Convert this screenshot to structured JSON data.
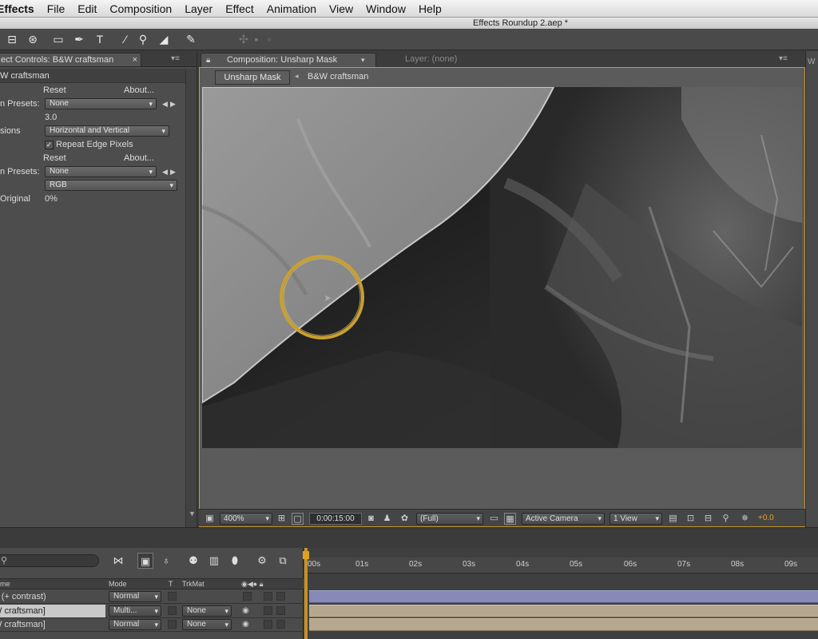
{
  "menubar": {
    "app_name": "Effects",
    "items": [
      "File",
      "Edit",
      "Composition",
      "Layer",
      "Effect",
      "Animation",
      "View",
      "Window",
      "Help"
    ]
  },
  "window": {
    "title": "Effects Roundup 2.aep *"
  },
  "effect_controls": {
    "tab_label": "ect Controls: B&W craftsman",
    "layer_name": "W craftsman",
    "effect1": {
      "reset": "Reset",
      "about": "About...",
      "presets_label": "n Presets:",
      "presets_value": "None",
      "blurriness_value": "3.0",
      "dimensions_label": "sions",
      "dimensions_value": "Horizontal and Vertical",
      "repeat_edge_label": "Repeat Edge Pixels",
      "repeat_edge_checked": true
    },
    "effect2": {
      "reset": "Reset",
      "about": "About...",
      "presets_label": "n Presets:",
      "presets_value": "None",
      "channel_value": "RGB",
      "blend_label": "Original",
      "blend_value": "0%"
    }
  },
  "composition": {
    "tab_label": "Composition: Unsharp Mask",
    "layer_tab_label": "Layer: (none)",
    "flowchart_current": "Unsharp Mask",
    "flowchart_next": "B&W craftsman",
    "footer": {
      "zoom": "400%",
      "timecode": "0:00:15:00",
      "resolution": "(Full)",
      "camera": "Active Camera",
      "views": "1 View",
      "exposure": "+0.0"
    }
  },
  "right_panel": {
    "initial": "W"
  },
  "timeline": {
    "columns": {
      "name": "me",
      "mode": "Mode",
      "t": "T",
      "trkmat": "TrkMat"
    },
    "ruler": [
      "00s",
      "01s",
      "02s",
      "03s",
      "04s",
      "05s",
      "06s",
      "07s",
      "08s",
      "09s"
    ],
    "layers": [
      {
        "name": "rt (+ contrast)",
        "mode": "Normal",
        "trkmat": ""
      },
      {
        "name": "W craftsman]",
        "mode": "Multi...",
        "trkmat": "None"
      },
      {
        "name": "W craftsman]",
        "mode": "Normal",
        "trkmat": "None"
      }
    ]
  },
  "colors": {
    "accent_orange": "#e8a12a",
    "comp_frame": "#d09a2a",
    "layer_bar_purple": "#8789b8",
    "layer_bar_tan": "#b6a88e",
    "highlight_ring": "#c9a030"
  },
  "icons": [
    "selection-tool-icon",
    "hand-tool-icon",
    "zoom-tool-icon",
    "rectangle-tool-icon",
    "pen-tool-icon",
    "type-tool-icon",
    "brush-tool-icon",
    "clone-stamp-icon",
    "eraser-icon",
    "puppet-pin-icon"
  ]
}
